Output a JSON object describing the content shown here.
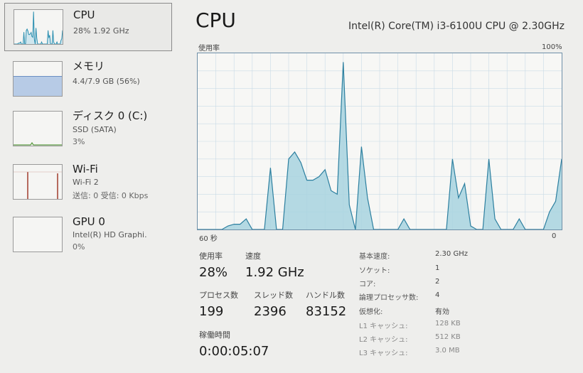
{
  "sidebar": {
    "items": [
      {
        "title": "CPU",
        "sub": "28%  1.92 GHz",
        "sub2": "",
        "graph_color": "#2b8fb0"
      },
      {
        "title": "メモリ",
        "sub": "4.4/7.9 GB (56%)",
        "sub2": "",
        "fill_fraction": 0.56,
        "graph_color": "#6b8fc4"
      },
      {
        "title": "ディスク 0 (C:)",
        "sub": "SSD (SATA)",
        "sub2": "3%",
        "graph_color": "#5a9a40"
      },
      {
        "title": "Wi-Fi",
        "sub": "Wi-Fi 2",
        "sub2": "送信: 0 受信: 0 Kbps",
        "graph_color": "#a13c2c"
      },
      {
        "title": "GPU 0",
        "sub": "Intel(R) HD Graphi.",
        "sub2": "0%",
        "graph_color": "#3a6aa0"
      }
    ]
  },
  "main": {
    "title": "CPU",
    "cpu_model": "Intel(R) Core(TM) i3-6100U CPU @ 2.30GHz",
    "graph": {
      "y_label": "使用率",
      "y_max_label": "100%",
      "x_left_label": "60 秒",
      "x_right_label": "0",
      "line_color": "#2c7f9f",
      "fill_color": "#a8d3df",
      "grid_color": "#c9dbe6"
    },
    "stats": {
      "usage_label": "使用率",
      "usage_value": "28%",
      "speed_label": "速度",
      "speed_value": "1.92 GHz",
      "processes_label": "プロセス数",
      "processes_value": "199",
      "threads_label": "スレッド数",
      "threads_value": "2396",
      "handles_label": "ハンドル数",
      "handles_value": "83152",
      "uptime_label": "稼働時間",
      "uptime_value": "0:00:05:07"
    },
    "specs": [
      {
        "label": "基本速度:",
        "value": "2.30 GHz"
      },
      {
        "label": "ソケット:",
        "value": "1"
      },
      {
        "label": "コア:",
        "value": "2"
      },
      {
        "label": "論理プロセッサ数:",
        "value": "4"
      },
      {
        "label": "仮想化:",
        "value": "有効"
      },
      {
        "label": "L1 キャッシュ:",
        "value": "128 KB"
      },
      {
        "label": "L2 キャッシュ:",
        "value": "512 KB"
      },
      {
        "label": "L3 キャッシュ:",
        "value": "3.0 MB"
      }
    ]
  },
  "chart_data": {
    "type": "area",
    "title": "",
    "xlabel": "",
    "ylabel": "使用率",
    "xlim": [
      60,
      0
    ],
    "ylim": [
      0,
      100
    ],
    "x": [
      60,
      59,
      58,
      57,
      56,
      55,
      54,
      53,
      52,
      51,
      50,
      49,
      48,
      47,
      46,
      45,
      44,
      43,
      42,
      41,
      40,
      39,
      38,
      37,
      36,
      35,
      34,
      33,
      32,
      31,
      30,
      29,
      28,
      27,
      26,
      25,
      24,
      23,
      22,
      21,
      20,
      19,
      18,
      17,
      16,
      15,
      14,
      13,
      12,
      11,
      10,
      9,
      8,
      7,
      6,
      5,
      4,
      3,
      2,
      1,
      0
    ],
    "series": [
      {
        "values": [
          0,
          0,
          0,
          0,
          0,
          2,
          3,
          3,
          6,
          0,
          0,
          0,
          35,
          0,
          0,
          40,
          44,
          38,
          28,
          28,
          30,
          34,
          22,
          20,
          95,
          14,
          0,
          47,
          18,
          0,
          0,
          0,
          0,
          0,
          6,
          0,
          0,
          0,
          0,
          0,
          0,
          0,
          40,
          18,
          26,
          2,
          0,
          0,
          40,
          6,
          0,
          0,
          0,
          6,
          0,
          0,
          0,
          0,
          10,
          16,
          40
        ]
      }
    ]
  }
}
